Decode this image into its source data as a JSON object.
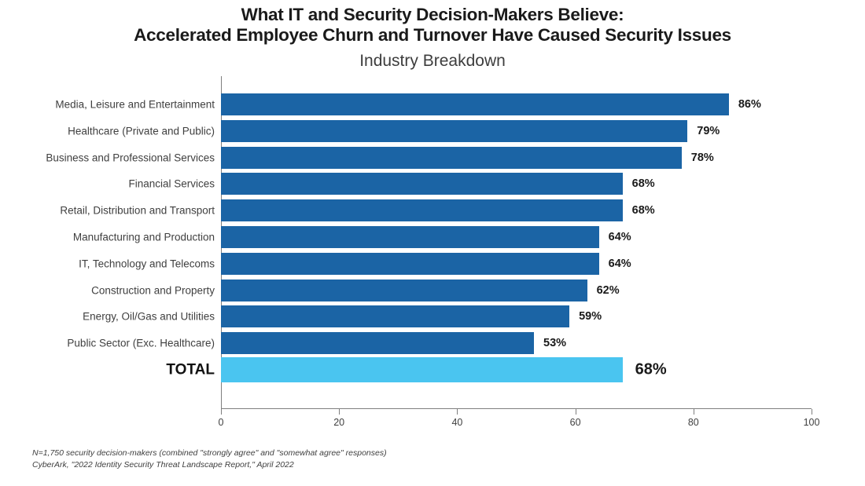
{
  "chart_data": {
    "type": "bar",
    "orientation": "horizontal",
    "title_lines": [
      "What IT and Security Decision-Makers Believe:",
      "Accelerated Employee Churn and Turnover Have Caused Security Issues"
    ],
    "subtitle": "Industry Breakdown",
    "xlabel": "",
    "ylabel": "",
    "xlim": [
      0,
      100
    ],
    "xticks": [
      0,
      20,
      40,
      60,
      80,
      100
    ],
    "xtick_labels": [
      "0",
      "20",
      "40",
      "60",
      "80",
      "100"
    ],
    "grid": false,
    "legend": null,
    "categories": [
      "Media, Leisure and Entertainment",
      "Healthcare (Private and Public)",
      "Business and Professional Services",
      "Financial Services",
      "Retail, Distribution and Transport",
      "Manufacturing and Production",
      "IT, Technology and Telecoms",
      "Construction and Property",
      "Energy, Oil/Gas and Utilities",
      "Public Sector (Exc. Healthcare)",
      "TOTAL"
    ],
    "values": [
      86,
      79,
      78,
      68,
      68,
      64,
      64,
      62,
      59,
      53,
      68
    ],
    "value_labels": [
      "86%",
      "79%",
      "78%",
      "68%",
      "68%",
      "64%",
      "64%",
      "62%",
      "59%",
      "53%",
      "68%"
    ],
    "bar_colors": [
      "#1b64a5",
      "#1b64a5",
      "#1b64a5",
      "#1b64a5",
      "#1b64a5",
      "#1b64a5",
      "#1b64a5",
      "#1b64a5",
      "#1b64a5",
      "#1b64a5",
      "#4ac5f0"
    ],
    "highlight_index": 10,
    "colors": {
      "series": "#1b64a5",
      "total": "#4ac5f0",
      "axis": "#7f7f7f",
      "text": "#3f3f3f",
      "title": "#1a1a1a",
      "background": "#ffffff"
    }
  },
  "footnotes": [
    "N=1,750 security decision-makers (combined \"strongly agree\" and \"somewhat agree\" responses)",
    "CyberArk, \"2022 Identity Security Threat Landscape Report,\" April 2022"
  ]
}
